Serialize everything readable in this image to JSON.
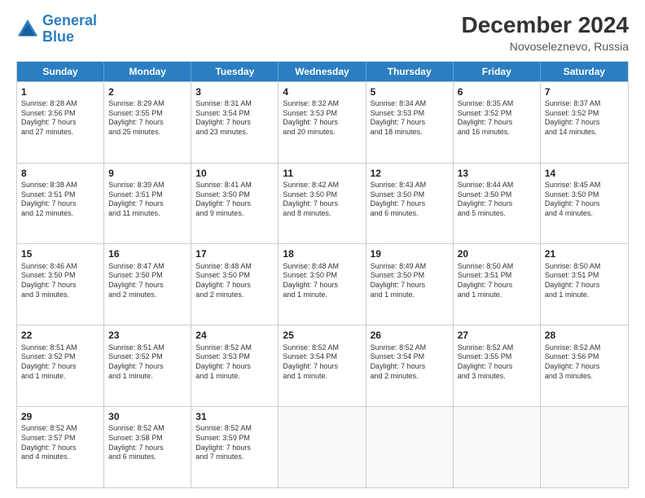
{
  "logo": {
    "line1": "General",
    "line2": "Blue"
  },
  "title": "December 2024",
  "subtitle": "Novoseleznevo, Russia",
  "days": [
    "Sunday",
    "Monday",
    "Tuesday",
    "Wednesday",
    "Thursday",
    "Friday",
    "Saturday"
  ],
  "rows": [
    [
      {
        "day": "1",
        "info": "Sunrise: 8:28 AM\nSunset: 3:56 PM\nDaylight: 7 hours\nand 27 minutes."
      },
      {
        "day": "2",
        "info": "Sunrise: 8:29 AM\nSunset: 3:55 PM\nDaylight: 7 hours\nand 25 minutes."
      },
      {
        "day": "3",
        "info": "Sunrise: 8:31 AM\nSunset: 3:54 PM\nDaylight: 7 hours\nand 23 minutes."
      },
      {
        "day": "4",
        "info": "Sunrise: 8:32 AM\nSunset: 3:53 PM\nDaylight: 7 hours\nand 20 minutes."
      },
      {
        "day": "5",
        "info": "Sunrise: 8:34 AM\nSunset: 3:53 PM\nDaylight: 7 hours\nand 18 minutes."
      },
      {
        "day": "6",
        "info": "Sunrise: 8:35 AM\nSunset: 3:52 PM\nDaylight: 7 hours\nand 16 minutes."
      },
      {
        "day": "7",
        "info": "Sunrise: 8:37 AM\nSunset: 3:52 PM\nDaylight: 7 hours\nand 14 minutes."
      }
    ],
    [
      {
        "day": "8",
        "info": "Sunrise: 8:38 AM\nSunset: 3:51 PM\nDaylight: 7 hours\nand 12 minutes."
      },
      {
        "day": "9",
        "info": "Sunrise: 8:39 AM\nSunset: 3:51 PM\nDaylight: 7 hours\nand 11 minutes."
      },
      {
        "day": "10",
        "info": "Sunrise: 8:41 AM\nSunset: 3:50 PM\nDaylight: 7 hours\nand 9 minutes."
      },
      {
        "day": "11",
        "info": "Sunrise: 8:42 AM\nSunset: 3:50 PM\nDaylight: 7 hours\nand 8 minutes."
      },
      {
        "day": "12",
        "info": "Sunrise: 8:43 AM\nSunset: 3:50 PM\nDaylight: 7 hours\nand 6 minutes."
      },
      {
        "day": "13",
        "info": "Sunrise: 8:44 AM\nSunset: 3:50 PM\nDaylight: 7 hours\nand 5 minutes."
      },
      {
        "day": "14",
        "info": "Sunrise: 8:45 AM\nSunset: 3:50 PM\nDaylight: 7 hours\nand 4 minutes."
      }
    ],
    [
      {
        "day": "15",
        "info": "Sunrise: 8:46 AM\nSunset: 3:50 PM\nDaylight: 7 hours\nand 3 minutes."
      },
      {
        "day": "16",
        "info": "Sunrise: 8:47 AM\nSunset: 3:50 PM\nDaylight: 7 hours\nand 2 minutes."
      },
      {
        "day": "17",
        "info": "Sunrise: 8:48 AM\nSunset: 3:50 PM\nDaylight: 7 hours\nand 2 minutes."
      },
      {
        "day": "18",
        "info": "Sunrise: 8:48 AM\nSunset: 3:50 PM\nDaylight: 7 hours\nand 1 minute."
      },
      {
        "day": "19",
        "info": "Sunrise: 8:49 AM\nSunset: 3:50 PM\nDaylight: 7 hours\nand 1 minute."
      },
      {
        "day": "20",
        "info": "Sunrise: 8:50 AM\nSunset: 3:51 PM\nDaylight: 7 hours\nand 1 minute."
      },
      {
        "day": "21",
        "info": "Sunrise: 8:50 AM\nSunset: 3:51 PM\nDaylight: 7 hours\nand 1 minute."
      }
    ],
    [
      {
        "day": "22",
        "info": "Sunrise: 8:51 AM\nSunset: 3:52 PM\nDaylight: 7 hours\nand 1 minute."
      },
      {
        "day": "23",
        "info": "Sunrise: 8:51 AM\nSunset: 3:52 PM\nDaylight: 7 hours\nand 1 minute."
      },
      {
        "day": "24",
        "info": "Sunrise: 8:52 AM\nSunset: 3:53 PM\nDaylight: 7 hours\nand 1 minute."
      },
      {
        "day": "25",
        "info": "Sunrise: 8:52 AM\nSunset: 3:54 PM\nDaylight: 7 hours\nand 1 minute."
      },
      {
        "day": "26",
        "info": "Sunrise: 8:52 AM\nSunset: 3:54 PM\nDaylight: 7 hours\nand 2 minutes."
      },
      {
        "day": "27",
        "info": "Sunrise: 8:52 AM\nSunset: 3:55 PM\nDaylight: 7 hours\nand 3 minutes."
      },
      {
        "day": "28",
        "info": "Sunrise: 8:52 AM\nSunset: 3:56 PM\nDaylight: 7 hours\nand 3 minutes."
      }
    ],
    [
      {
        "day": "29",
        "info": "Sunrise: 8:52 AM\nSunset: 3:57 PM\nDaylight: 7 hours\nand 4 minutes."
      },
      {
        "day": "30",
        "info": "Sunrise: 8:52 AM\nSunset: 3:58 PM\nDaylight: 7 hours\nand 6 minutes."
      },
      {
        "day": "31",
        "info": "Sunrise: 8:52 AM\nSunset: 3:59 PM\nDaylight: 7 hours\nand 7 minutes."
      },
      {
        "day": "",
        "info": ""
      },
      {
        "day": "",
        "info": ""
      },
      {
        "day": "",
        "info": ""
      },
      {
        "day": "",
        "info": ""
      }
    ]
  ]
}
